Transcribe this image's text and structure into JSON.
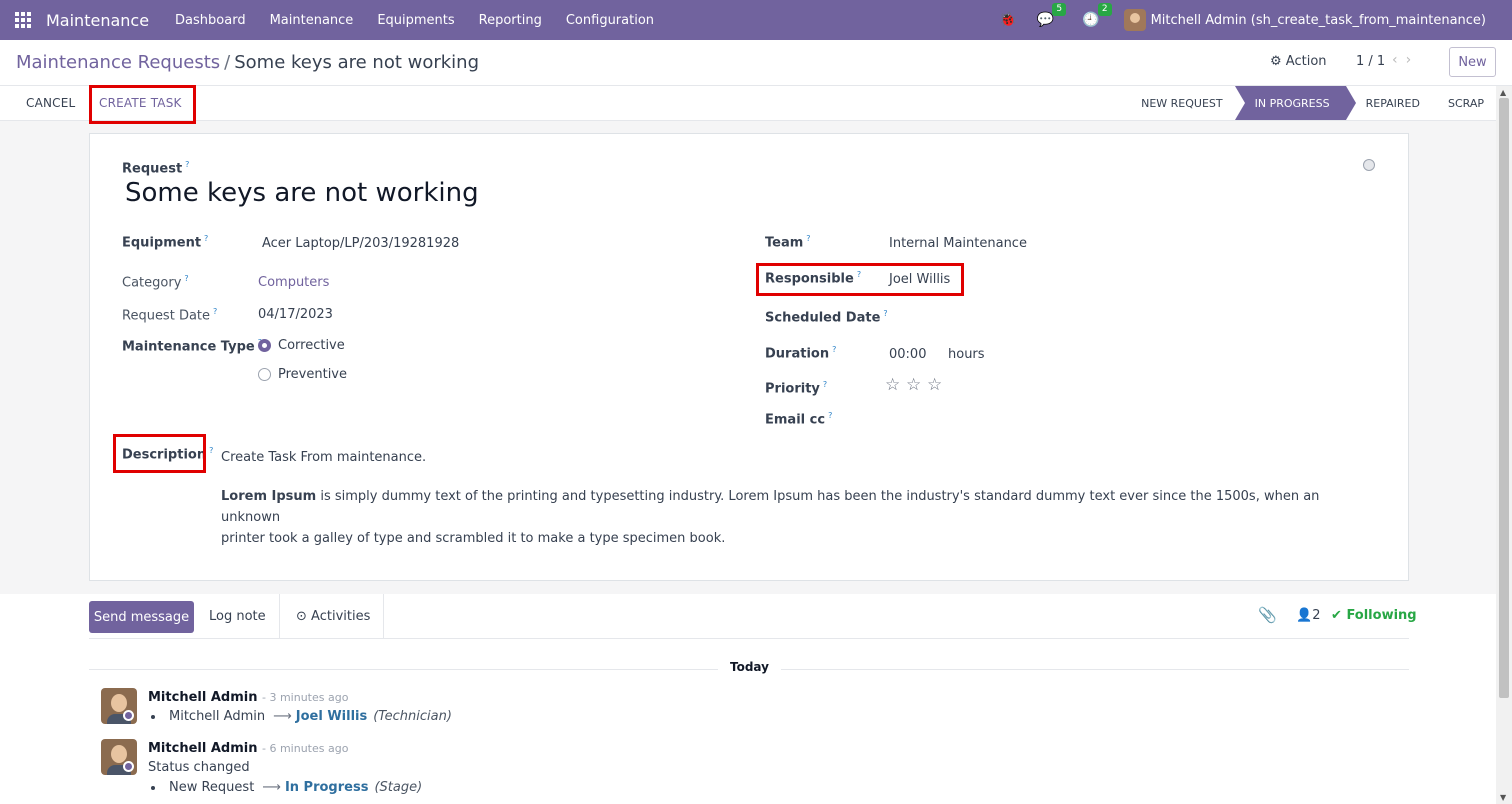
{
  "navbar": {
    "brand": "Maintenance",
    "menu": [
      "Dashboard",
      "Maintenance",
      "Equipments",
      "Reporting",
      "Configuration"
    ],
    "messages_count": "5",
    "activities_count": "2",
    "user": "Mitchell Admin (sh_create_task_from_maintenance)"
  },
  "control": {
    "breadcrumb_parent": "Maintenance Requests",
    "breadcrumb_sep": "/",
    "breadcrumb_current": "Some keys are not working",
    "action_label": "Action",
    "pager": "1 / 1",
    "new_label": "New"
  },
  "statusbar": {
    "cancel": "CANCEL",
    "create_task": "CREATE TASK",
    "stages": [
      "NEW REQUEST",
      "IN PROGRESS",
      "REPAIRED",
      "SCRAP"
    ],
    "active_stage": "IN PROGRESS"
  },
  "form": {
    "request_label": "Request",
    "title": "Some keys are not working",
    "equipment_label": "Equipment",
    "equipment": "Acer Laptop/LP/203/19281928",
    "category_label": "Category",
    "category": "Computers",
    "request_date_label": "Request Date",
    "request_date": "04/17/2023",
    "maintenance_type_label": "Maintenance Type",
    "type_options": [
      "Corrective",
      "Preventive"
    ],
    "type_selected": "Corrective",
    "team_label": "Team",
    "team": "Internal Maintenance",
    "responsible_label": "Responsible",
    "responsible": "Joel Willis",
    "scheduled_date_label": "Scheduled Date",
    "duration_label": "Duration",
    "duration": "00:00",
    "duration_unit": "hours",
    "priority_label": "Priority",
    "priority_stars": 0,
    "email_cc_label": "Email cc",
    "description_label": "Description",
    "description_line1": "Create Task From maintenance.",
    "description_bold": "Lorem Ipsum",
    "description_rest1": " is simply dummy text of the printing and typesetting industry. Lorem Ipsum has been the industry's standard dummy text ever since the 1500s, when an unknown",
    "description_rest2": "printer took a galley of type and scrambled it to make a type specimen book."
  },
  "chatter": {
    "send_message": "Send message",
    "log_note": "Log note",
    "activities": "Activities",
    "followers_count": "2",
    "following": "Following",
    "today": "Today",
    "messages": [
      {
        "author": "Mitchell Admin",
        "time": "- 3 minutes ago",
        "old": "Mitchell Admin",
        "new": "Joel Willis",
        "field": "(Technician)"
      },
      {
        "author": "Mitchell Admin",
        "time": "- 6 minutes ago",
        "body": "Status changed",
        "old": "New Request",
        "new": "In Progress",
        "field": "(Stage)"
      }
    ]
  },
  "colors": {
    "brand": "#71639e",
    "highlight": "#e00000",
    "following": "#28a745"
  }
}
